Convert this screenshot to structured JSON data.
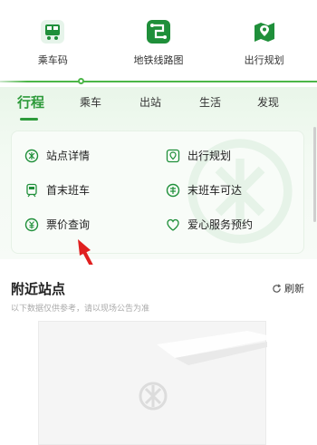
{
  "top_nav": [
    {
      "label": "乘车码",
      "icon": "bus-code-icon"
    },
    {
      "label": "地铁线路图",
      "icon": "metro-map-icon"
    },
    {
      "label": "出行规划",
      "icon": "route-plan-icon"
    }
  ],
  "tabs": [
    "行程",
    "乘车",
    "出站",
    "生活",
    "发现"
  ],
  "active_tab": "行程",
  "card_items": [
    {
      "label": "站点详情",
      "icon": "metro-logo-icon"
    },
    {
      "label": "出行规划",
      "icon": "map-pin-icon"
    },
    {
      "label": "首末班车",
      "icon": "train-icon"
    },
    {
      "label": "末班车可达",
      "icon": "last-train-icon"
    },
    {
      "label": "票价查询",
      "icon": "fare-icon"
    },
    {
      "label": "爱心服务预约",
      "icon": "heart-icon"
    }
  ],
  "nearby": {
    "title": "附近站点",
    "refresh_label": "刷新",
    "disclaimer": "以下数据仅供参考，请以现场公告为准"
  },
  "colors": {
    "accent": "#2d9a3a",
    "icon_green": "#1f8f3a",
    "arrow": "#e02020"
  }
}
